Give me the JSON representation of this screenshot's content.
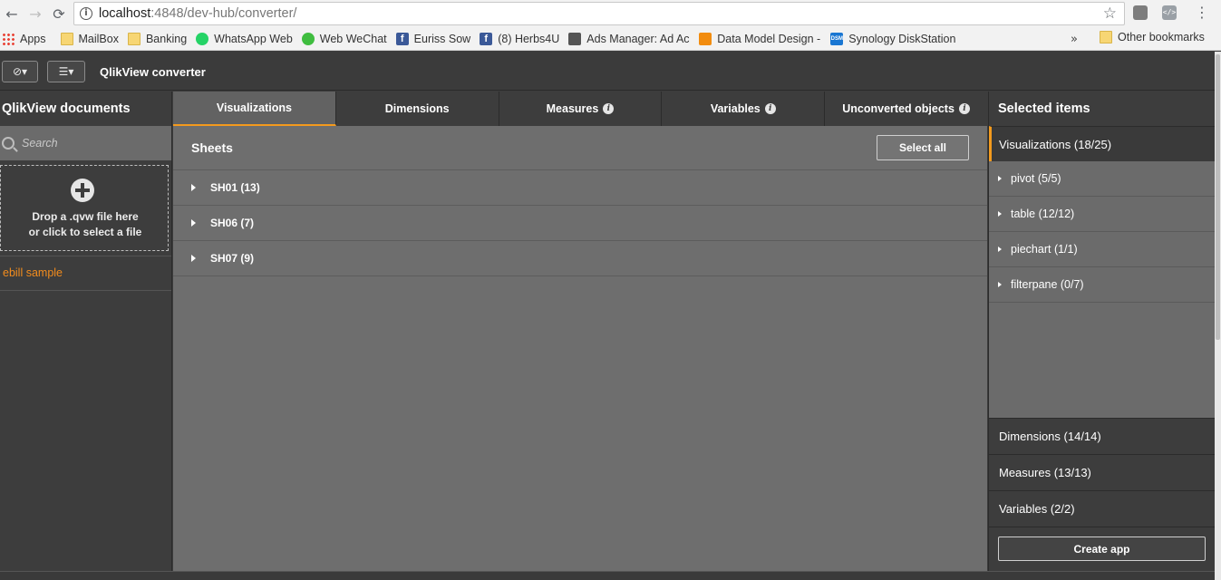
{
  "browser": {
    "url_host": "localhost",
    "url_path": ":4848/dev-hub/converter/",
    "bookmarks": [
      {
        "label": "Apps",
        "icon": "apps-grid-icon"
      },
      {
        "label": "MailBox",
        "icon": "folder-icon"
      },
      {
        "label": "Banking",
        "icon": "folder-icon"
      },
      {
        "label": "WhatsApp Web",
        "icon": "whatsapp-icon"
      },
      {
        "label": "Web WeChat",
        "icon": "wechat-icon"
      },
      {
        "label": "Euriss Sow",
        "icon": "facebook-icon"
      },
      {
        "label": "(8) Herbs4U",
        "icon": "facebook-icon"
      },
      {
        "label": "Ads Manager: Ad Acc",
        "icon": "ads-manager-icon"
      },
      {
        "label": "Data Model Design - ",
        "icon": "data-model-icon"
      },
      {
        "label": "Synology DiskStation",
        "icon": "dsm-icon"
      }
    ],
    "more_label": "»",
    "other_bookmarks": "Other bookmarks",
    "dsm_badge": "DSM"
  },
  "app": {
    "title": "QlikView converter",
    "nav_icon": "compass-icon",
    "menu_icon": "list-icon"
  },
  "left": {
    "title": "QlikView documents",
    "search_placeholder": "Search",
    "drop_line1": "Drop a .qvw file here",
    "drop_line2": "or click to select a file",
    "documents": [
      "ebill sample"
    ]
  },
  "center": {
    "tabs": [
      {
        "label": "Visualizations",
        "info": false,
        "active": true
      },
      {
        "label": "Dimensions",
        "info": false,
        "active": false
      },
      {
        "label": "Measures",
        "info": true,
        "active": false
      },
      {
        "label": "Variables",
        "info": true,
        "active": false
      },
      {
        "label": "Unconverted objects",
        "info": true,
        "active": false
      }
    ],
    "sheets_title": "Sheets",
    "select_all": "Select all",
    "sheets": [
      "SH01 (13)",
      "SH06 (7)",
      "SH07 (9)"
    ]
  },
  "right": {
    "title": "Selected items",
    "visualizations_label": "Visualizations",
    "visualizations_count": "(18/25)",
    "viz_items": [
      "pivot (5/5)",
      "table (12/12)",
      "piechart (1/1)",
      "filterpane (0/7)"
    ],
    "categories": [
      "Dimensions (14/14)",
      "Measures (13/13)",
      "Variables (2/2)"
    ],
    "create_app": "Create app"
  },
  "colors": {
    "accent": "#f39a1d",
    "document_link": "#f28c1d"
  }
}
